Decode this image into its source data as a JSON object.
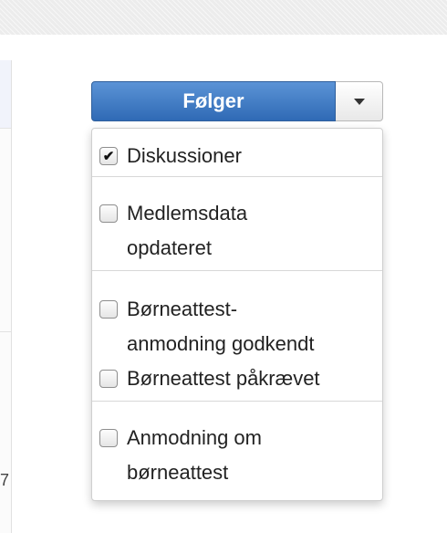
{
  "left_panel": {
    "number": "7"
  },
  "follow": {
    "label": "Følger"
  },
  "menu": {
    "items": [
      {
        "label": "Diskussioner",
        "checked": true
      },
      {
        "label_line1": "Medlemsdata",
        "label_line2": "opdateret",
        "checked": false
      },
      {
        "label_line1": "Børneattest-",
        "label_line2": "anmodning godkendt",
        "checked": false
      },
      {
        "label": "Børneattest påkrævet",
        "checked": false
      },
      {
        "label_line1": "Anmodning om",
        "label_line2": "børneattest",
        "checked": false
      }
    ]
  },
  "icons": {
    "check": "check-mark-icon",
    "toggle": "caret-down-icon"
  }
}
